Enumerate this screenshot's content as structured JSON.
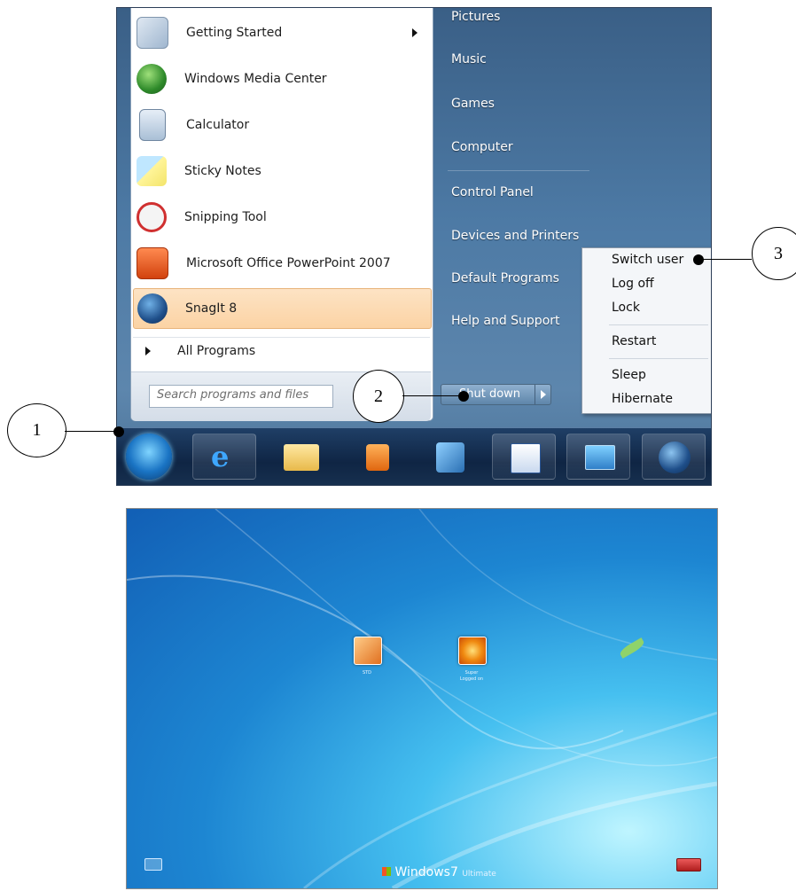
{
  "start_menu": {
    "programs": [
      {
        "label": "Getting Started",
        "icon": "getting-started-icon",
        "submenu": true
      },
      {
        "label": "Windows Media Center",
        "icon": "windows-media-center-icon"
      },
      {
        "label": "Calculator",
        "icon": "calculator-icon"
      },
      {
        "label": "Sticky Notes",
        "icon": "sticky-notes-icon"
      },
      {
        "label": "Snipping Tool",
        "icon": "snipping-tool-icon"
      },
      {
        "label": "Microsoft Office PowerPoint 2007",
        "icon": "powerpoint-icon"
      },
      {
        "label": "SnagIt 8",
        "icon": "snagit-icon",
        "highlighted": true
      }
    ],
    "all_programs_label": "All Programs",
    "search_placeholder": "Search programs and files",
    "right_items": [
      "Pictures",
      "Music",
      "Games",
      "Computer",
      "Control Panel",
      "Devices and Printers",
      "Default Programs",
      "Help and Support"
    ],
    "shutdown_label": "Shut down",
    "flyout": [
      "Switch user",
      "Log off",
      "Lock",
      "Restart",
      "Sleep",
      "Hibernate"
    ]
  },
  "taskbar": {
    "icons": [
      "start-orb-icon",
      "internet-explorer-icon",
      "windows-explorer-icon",
      "media-player-icon",
      "install-wizard-icon",
      "word-icon",
      "remote-desktop-icon",
      "snagit-icon"
    ]
  },
  "callouts": [
    "1",
    "2",
    "3"
  ],
  "login_screen": {
    "users": [
      {
        "name": "STD",
        "status": ""
      },
      {
        "name": "Super",
        "status": "Logged on"
      }
    ],
    "brand": "Windows",
    "brand_version": "7",
    "edition": "Ultimate",
    "colors": {
      "accent_orange": "#fbd3a4",
      "taskbar": "#0f2544",
      "power_button": "#c72b2b"
    }
  }
}
